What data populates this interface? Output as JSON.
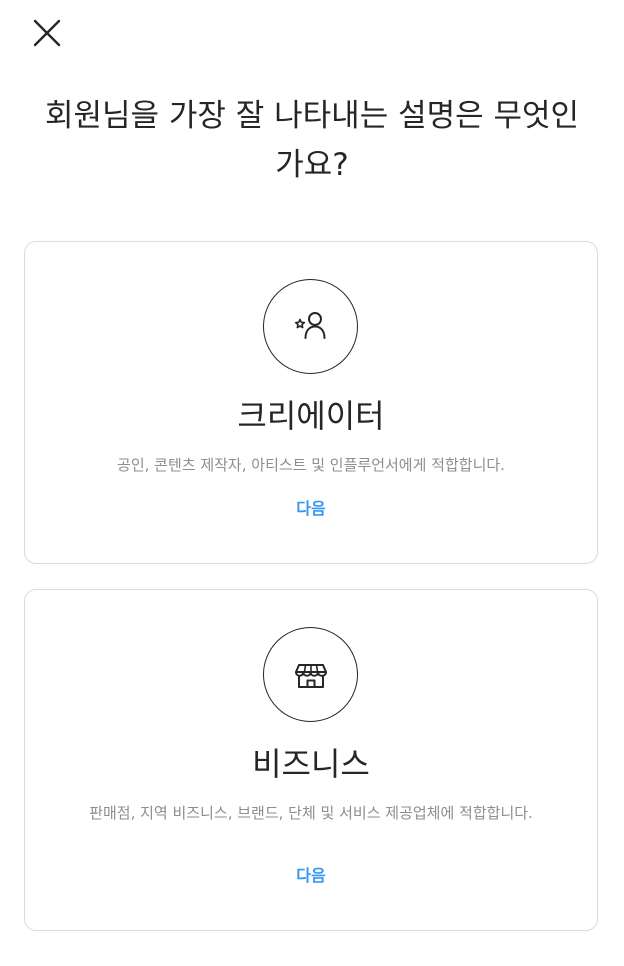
{
  "header": {
    "close_icon": "close-icon",
    "title": "회원님을 가장 잘 나타내는 설명은 무엇인가요?"
  },
  "cards": [
    {
      "icon": "person-star-icon",
      "title": "크리에이터",
      "description": "공인, 콘텐츠 제작자, 아티스트 및 인플루언서에게 적합합니다.",
      "next_label": "다음"
    },
    {
      "icon": "storefront-icon",
      "title": "비즈니스",
      "description": "판매점, 지역 비즈니스, 브랜드, 단체 및 서비스 제공업체에 적합합니다.",
      "next_label": "다음"
    }
  ],
  "colors": {
    "text_primary": "#262626",
    "text_secondary": "#8e8e8e",
    "link_blue": "#3897f0",
    "border": "#dbdbdb"
  }
}
